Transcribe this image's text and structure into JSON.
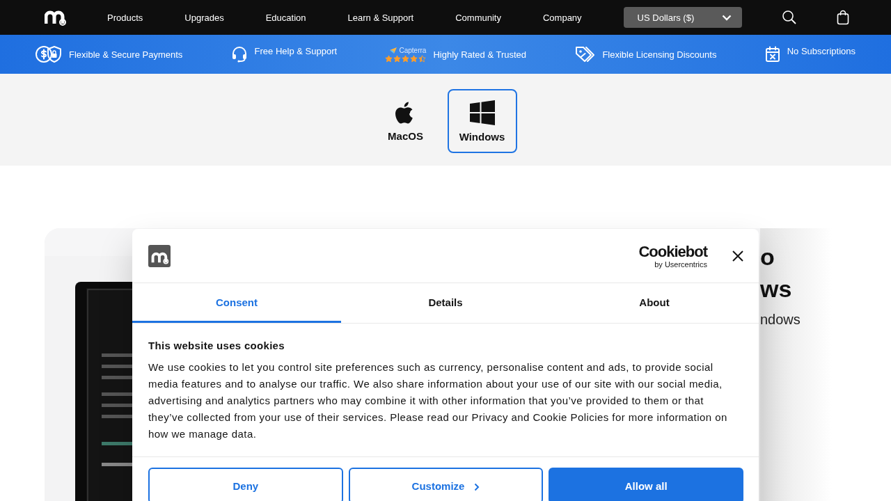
{
  "nav": {
    "items": [
      {
        "label": "Products"
      },
      {
        "label": "Upgrades"
      },
      {
        "label": "Education"
      },
      {
        "label": "Learn & Support"
      },
      {
        "label": "Community"
      },
      {
        "label": "Company"
      }
    ],
    "currency": "US Dollars ($)"
  },
  "benefits": [
    {
      "kind": "payments",
      "label": "Flexible & Secure Payments"
    },
    {
      "kind": "support",
      "label": "Free Help & Support"
    },
    {
      "kind": "rating",
      "badge": "Capterra",
      "stars": 4.5,
      "label": "Highly Rated & Trusted"
    },
    {
      "kind": "discount",
      "label": "Flexible Licensing Discounts"
    },
    {
      "kind": "calendar",
      "label": "No Subscriptions"
    }
  ],
  "platforms": [
    {
      "kind": "apple",
      "label": "MacOS",
      "selected": false
    },
    {
      "kind": "windows",
      "label": "Windows",
      "selected": true
    }
  ],
  "product": {
    "image": {
      "kind": "picture"
    },
    "title_lines": [
      "o",
      "ws"
    ],
    "subtitle": "ndows"
  },
  "cookie_dialog": {
    "brand": "Cookiebot",
    "brand_tagline": "by Usercentrics",
    "tabs": [
      {
        "label": "Consent",
        "selected": true
      },
      {
        "label": "Details",
        "selected": false
      },
      {
        "label": "About",
        "selected": false
      }
    ],
    "heading": "This website uses cookies",
    "body": "We use cookies to let you control site preferences such as currency, personalise content and ads, to provide social media features and to analyse our traffic. We also share information about your use of our site with our social media, advertising and analytics partners who may combine it with other information that you’ve provided to them or that they’ve collected from your use of their services. Please read our Privacy and Cookie Policies for more information on how we manage data.",
    "buttons": [
      {
        "kind": "outline",
        "label": "Deny"
      },
      {
        "kind": "chevron",
        "label": "Customize"
      },
      {
        "kind": "primary",
        "label": "Allow all"
      }
    ]
  }
}
